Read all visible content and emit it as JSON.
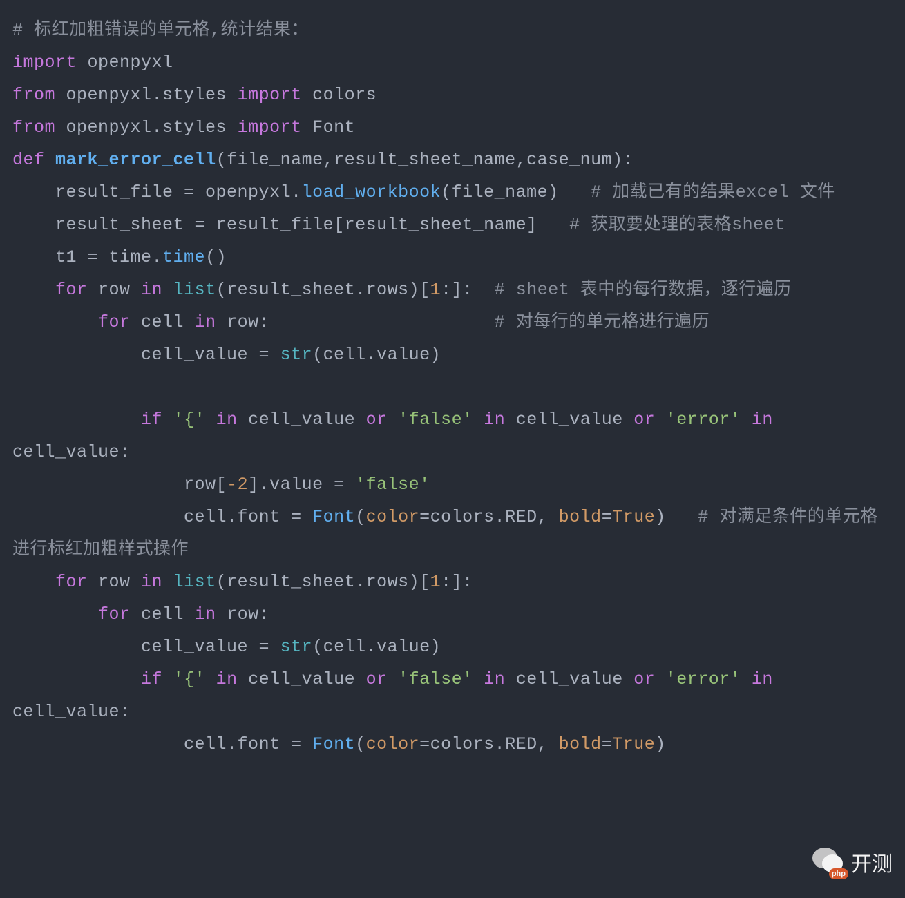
{
  "code": {
    "tokens": [
      [
        [
          "c-comment",
          "# 标红加粗错误的单元格,统计结果："
        ]
      ],
      [
        [
          "c-keyword",
          "import"
        ],
        [
          "c-ident",
          " openpyxl"
        ]
      ],
      [
        [
          "c-keyword",
          "from"
        ],
        [
          "c-ident",
          " openpyxl.styles "
        ],
        [
          "c-keyword",
          "import"
        ],
        [
          "c-ident",
          " colors"
        ]
      ],
      [
        [
          "c-keyword",
          "from"
        ],
        [
          "c-ident",
          " openpyxl.styles "
        ],
        [
          "c-keyword",
          "import"
        ],
        [
          "c-ident",
          " Font"
        ]
      ],
      [
        [
          "c-keyword",
          "def"
        ],
        [
          "c-ident",
          " "
        ],
        [
          "c-funcdef",
          "mark_error_cell"
        ],
        [
          "c-punct",
          "(file_name,result_sheet_name,case_num):"
        ]
      ],
      [
        [
          "c-ident",
          "    result_file = openpyxl."
        ],
        [
          "c-func",
          "load_workbook"
        ],
        [
          "c-punct",
          "(file_name)   "
        ],
        [
          "c-comment",
          "# 加载已有的结果excel 文件"
        ]
      ],
      [
        [
          "c-ident",
          "    result_sheet = result_file[result_sheet_name]   "
        ],
        [
          "c-comment",
          "# 获取要处理的表格sheet"
        ]
      ],
      [
        [
          "c-ident",
          "    t1 = time."
        ],
        [
          "c-func",
          "time"
        ],
        [
          "c-punct",
          "()"
        ]
      ],
      [
        [
          "c-ident",
          "    "
        ],
        [
          "c-keyword",
          "for"
        ],
        [
          "c-ident",
          " row "
        ],
        [
          "c-keyword",
          "in"
        ],
        [
          "c-ident",
          " "
        ],
        [
          "c-builtin",
          "list"
        ],
        [
          "c-punct",
          "(result_sheet.rows)["
        ],
        [
          "c-number",
          "1"
        ],
        [
          "c-punct",
          ":]:  "
        ],
        [
          "c-comment",
          "# sheet 表中的每行数据，逐行遍历"
        ]
      ],
      [
        [
          "c-ident",
          "        "
        ],
        [
          "c-keyword",
          "for"
        ],
        [
          "c-ident",
          " cell "
        ],
        [
          "c-keyword",
          "in"
        ],
        [
          "c-ident",
          " row:                     "
        ],
        [
          "c-comment",
          "# 对每行的单元格进行遍历"
        ]
      ],
      [
        [
          "c-ident",
          "            cell_value = "
        ],
        [
          "c-builtin",
          "str"
        ],
        [
          "c-punct",
          "(cell.value)"
        ]
      ],
      [
        [
          "c-ident",
          " "
        ]
      ],
      [
        [
          "c-ident",
          "            "
        ],
        [
          "c-keyword",
          "if"
        ],
        [
          "c-ident",
          " "
        ],
        [
          "c-string",
          "'{'"
        ],
        [
          "c-ident",
          " "
        ],
        [
          "c-keyword",
          "in"
        ],
        [
          "c-ident",
          " cell_value "
        ],
        [
          "c-keyword",
          "or"
        ],
        [
          "c-ident",
          " "
        ],
        [
          "c-string",
          "'false'"
        ],
        [
          "c-ident",
          " "
        ],
        [
          "c-keyword",
          "in"
        ],
        [
          "c-ident",
          " cell_value "
        ],
        [
          "c-keyword",
          "or"
        ],
        [
          "c-ident",
          " "
        ],
        [
          "c-string",
          "'error'"
        ],
        [
          "c-ident",
          " "
        ],
        [
          "c-keyword",
          "in"
        ],
        [
          "c-ident",
          " cell_value:"
        ]
      ],
      [
        [
          "c-ident",
          "                row["
        ],
        [
          "c-number",
          "-2"
        ],
        [
          "c-punct",
          "].value = "
        ],
        [
          "c-string",
          "'false'"
        ]
      ],
      [
        [
          "c-ident",
          "                cell.font = "
        ],
        [
          "c-func",
          "Font"
        ],
        [
          "c-punct",
          "("
        ],
        [
          "c-param",
          "color"
        ],
        [
          "c-punct",
          "=colors.RED, "
        ],
        [
          "c-param",
          "bold"
        ],
        [
          "c-punct",
          "="
        ],
        [
          "c-const",
          "True"
        ],
        [
          "c-punct",
          ")   "
        ],
        [
          "c-comment",
          "# 对满足条件的单元格进行标红加粗样式操作"
        ]
      ],
      [
        [
          "c-ident",
          "    "
        ],
        [
          "c-keyword",
          "for"
        ],
        [
          "c-ident",
          " row "
        ],
        [
          "c-keyword",
          "in"
        ],
        [
          "c-ident",
          " "
        ],
        [
          "c-builtin",
          "list"
        ],
        [
          "c-punct",
          "(result_sheet.rows)["
        ],
        [
          "c-number",
          "1"
        ],
        [
          "c-punct",
          ":]:"
        ]
      ],
      [
        [
          "c-ident",
          "        "
        ],
        [
          "c-keyword",
          "for"
        ],
        [
          "c-ident",
          " cell "
        ],
        [
          "c-keyword",
          "in"
        ],
        [
          "c-ident",
          " row:"
        ]
      ],
      [
        [
          "c-ident",
          "            cell_value = "
        ],
        [
          "c-builtin",
          "str"
        ],
        [
          "c-punct",
          "(cell.value)"
        ]
      ],
      [
        [
          "c-ident",
          "            "
        ],
        [
          "c-keyword",
          "if"
        ],
        [
          "c-ident",
          " "
        ],
        [
          "c-string",
          "'{'"
        ],
        [
          "c-ident",
          " "
        ],
        [
          "c-keyword",
          "in"
        ],
        [
          "c-ident",
          " cell_value "
        ],
        [
          "c-keyword",
          "or"
        ],
        [
          "c-ident",
          " "
        ],
        [
          "c-string",
          "'false'"
        ],
        [
          "c-ident",
          " "
        ],
        [
          "c-keyword",
          "in"
        ],
        [
          "c-ident",
          " cell_value "
        ],
        [
          "c-keyword",
          "or"
        ],
        [
          "c-ident",
          " "
        ],
        [
          "c-string",
          "'error'"
        ],
        [
          "c-ident",
          " "
        ],
        [
          "c-keyword",
          "in"
        ],
        [
          "c-ident",
          " cell_value:"
        ]
      ],
      [
        [
          "c-ident",
          "                cell.font = "
        ],
        [
          "c-func",
          "Font"
        ],
        [
          "c-punct",
          "("
        ],
        [
          "c-param",
          "color"
        ],
        [
          "c-punct",
          "=colors.RED, "
        ],
        [
          "c-param",
          "bold"
        ],
        [
          "c-punct",
          "="
        ],
        [
          "c-const",
          "True"
        ],
        [
          "c-punct",
          ")"
        ]
      ]
    ]
  },
  "watermark": {
    "text": "开测",
    "badge": "php"
  }
}
